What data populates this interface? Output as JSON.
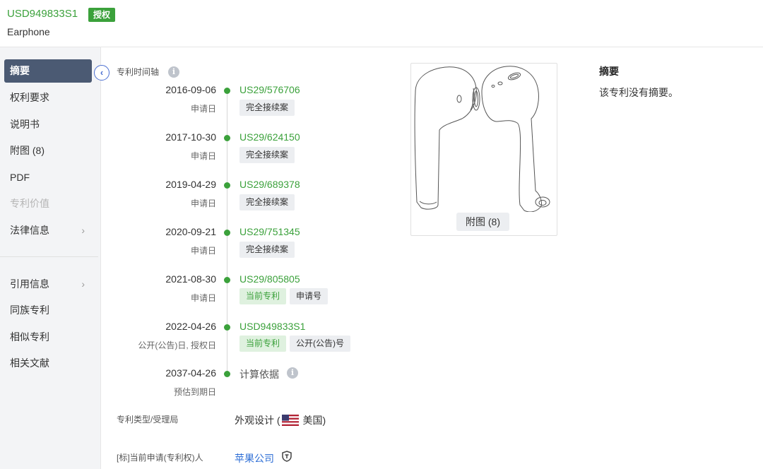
{
  "header": {
    "patent_number": "USD949833S1",
    "status_badge": "授权",
    "title": "Earphone"
  },
  "sidebar": {
    "items": [
      {
        "label": "摘要",
        "active": true
      },
      {
        "label": "权利要求"
      },
      {
        "label": "说明书"
      },
      {
        "label": "附图 (8)"
      },
      {
        "label": "PDF"
      },
      {
        "label": "专利价值",
        "disabled": true
      },
      {
        "label": "法律信息",
        "chevron": "›"
      },
      {
        "label": "引用信息",
        "chevron": "›"
      },
      {
        "label": "同族专利"
      },
      {
        "label": "相似专利"
      },
      {
        "label": "相关文献"
      }
    ]
  },
  "collapse_glyph": "‹",
  "timeline": {
    "label": "专利时间轴",
    "info_glyph": "i",
    "events": [
      {
        "date": "2016-09-06",
        "sub": "申请日",
        "number": "US29/576706",
        "tags": [
          "完全接续案"
        ]
      },
      {
        "date": "2017-10-30",
        "sub": "申请日",
        "number": "US29/624150",
        "tags": [
          "完全接续案"
        ]
      },
      {
        "date": "2019-04-29",
        "sub": "申请日",
        "number": "US29/689378",
        "tags": [
          "完全接续案"
        ]
      },
      {
        "date": "2020-09-21",
        "sub": "申请日",
        "number": "US29/751345",
        "tags": [
          "完全接续案"
        ]
      },
      {
        "date": "2021-08-30",
        "sub": "申请日",
        "number": "US29/805805",
        "tags": [
          "当前专利",
          "申请号"
        ]
      },
      {
        "date": "2022-04-26",
        "sub": "公开(公告)日, 授权日",
        "number": "USD949833S1",
        "tags": [
          "当前专利",
          "公开(公告)号"
        ]
      },
      {
        "date": "2037-04-26",
        "sub": "预估到期日",
        "number": "计算依据",
        "tags": []
      }
    ]
  },
  "fields": {
    "type_label": "专利类型/受理局",
    "type_value_prefix": "外观设计 (",
    "type_value_suffix": " 美国)",
    "applicant_label": "[标]当前申请(专利权)人",
    "applicant_value": "苹果公司"
  },
  "figure": {
    "badge": "附图 (8)"
  },
  "abstract": {
    "title": "摘要",
    "text": "该专利没有摘要。"
  },
  "colors": {
    "green": "#3ba13b",
    "nav_active": "#4b5a73",
    "link_blue": "#2f6fd6"
  }
}
